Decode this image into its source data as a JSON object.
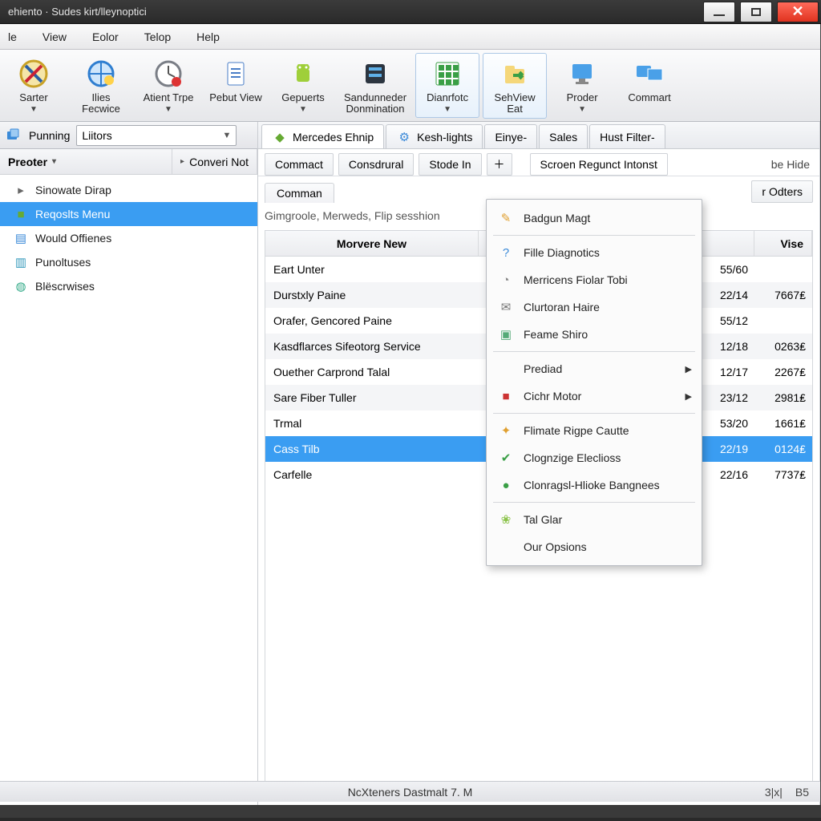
{
  "window": {
    "title": "ehiento · Sudes kirt/lleynoptici"
  },
  "menubar": [
    "le",
    "View",
    "Eolor",
    "Telop",
    "Help"
  ],
  "toolbar": [
    {
      "label": "Sarter",
      "dd": "▼",
      "icon": "compass-x-icon"
    },
    {
      "label": "Ilies\nFecwice",
      "dd": "",
      "icon": "globe-icon"
    },
    {
      "label": "Atient Trpe",
      "dd": "▼",
      "icon": "clock-dot-icon"
    },
    {
      "label": "Pebut View",
      "dd": "",
      "icon": "document-lines-icon"
    },
    {
      "label": "Gepuerts",
      "dd": "▼",
      "icon": "android-icon"
    },
    {
      "label": "Sandunneder\nDonmination",
      "dd": "",
      "icon": "server-dark-icon"
    },
    {
      "label": "Dianrfotc",
      "dd": "▼",
      "icon": "grid-green-icon",
      "active": true
    },
    {
      "label": "SehView\nEat",
      "dd": "",
      "icon": "folder-arrow-icon",
      "active": true
    },
    {
      "label": "Proder",
      "dd": "▼",
      "icon": "monitor-icon"
    },
    {
      "label": "Commart",
      "dd": "",
      "icon": "monitors-icon"
    }
  ],
  "subbar": {
    "label": "Punning",
    "combo": "Liitors"
  },
  "sidebar": {
    "hdr_left": "Preoter",
    "hdr_right": "Converi Not",
    "items": [
      {
        "icon": "chevron-right-icon",
        "label": "Sinowate Dirap"
      },
      {
        "icon": "green-square-icon",
        "label": "Reqoslts Menu",
        "sel": true
      },
      {
        "icon": "doc-blue-icon",
        "label": "Would Offienes"
      },
      {
        "icon": "doc-cyan-icon",
        "label": "Punoltuses"
      },
      {
        "icon": "globe-small-icon",
        "label": "Blëscrwises"
      }
    ]
  },
  "tabs1": [
    {
      "label": "Mercedes Ehnip",
      "icon": "shield-green-icon",
      "active": true
    },
    {
      "label": "Kesh-lights",
      "icon": "gear-blue-icon"
    },
    {
      "label": "Einye-"
    },
    {
      "label": "Sales"
    },
    {
      "label": "Hust Filter-"
    }
  ],
  "tabs2": {
    "left": [
      "Commact",
      "Consdrural",
      "Stode In"
    ],
    "right": "Scroen Regunct Intonst",
    "hide": "be Hide",
    "odters": "r Odters"
  },
  "inner": {
    "comman": "Comman",
    "sub": "Gimgroole, Merweds, Flip sesshion"
  },
  "table": {
    "head": {
      "name": "Morvere New",
      "vise": "Vise"
    },
    "rows": [
      {
        "name": "Eart Unter",
        "date": "55/60",
        "vise": ""
      },
      {
        "name": "Durstxly Paine",
        "date": "22/14",
        "vise": "7667₤"
      },
      {
        "name": "Orafer, Gencored Paine",
        "date": "55/12",
        "vise": ""
      },
      {
        "name": "Kasdflarces Sifeotorg Service",
        "date": "12/18",
        "vise": "0263₤"
      },
      {
        "name": "Ouether Carprond Talal",
        "date": "12/17",
        "vise": "2267₤"
      },
      {
        "name": "Sare Fiber Tuller",
        "date": "23/12",
        "vise": "2981₤"
      },
      {
        "name": "Trmal",
        "date": "53/20",
        "vise": "1661₤"
      },
      {
        "name": "Cass Tilb",
        "date": "22/19",
        "vise": "0124₤",
        "sel": true
      },
      {
        "name": "Carfelle",
        "date": "22/16",
        "vise": "7737₤"
      }
    ]
  },
  "ctx": [
    {
      "icon": "pencil-icon",
      "label": "Badgun Magt"
    },
    {
      "sep": true
    },
    {
      "icon": "help-icon",
      "label": "Fille Diagnotics"
    },
    {
      "icon": "clock-grey-icon",
      "label": "Merricens Fiolar Tobi"
    },
    {
      "icon": "mail-icon",
      "label": "Clurtoran Haire"
    },
    {
      "icon": "window-icon",
      "label": "Feame Shiro"
    },
    {
      "sep": true
    },
    {
      "icon": "blank-icon",
      "label": "Prediad",
      "sub": true
    },
    {
      "icon": "red-square-icon",
      "label": "Cichr Motor",
      "sub": true
    },
    {
      "sep": true
    },
    {
      "icon": "paint-icon",
      "label": "Flimate Rigpe Cautte"
    },
    {
      "icon": "green-check-icon",
      "label": "Clognzige Eleclioss"
    },
    {
      "icon": "green-dot-icon",
      "label": "Clonragsl-Hlioke Bangnees"
    },
    {
      "sep": true
    },
    {
      "icon": "leaf-icon",
      "label": "Tal Glar"
    },
    {
      "icon": "blank-icon",
      "label": "Our Opsions"
    }
  ],
  "status": {
    "mid": "NcXteners Dastmalt 7. M",
    "r1": "3|x|",
    "r2": "B5"
  }
}
